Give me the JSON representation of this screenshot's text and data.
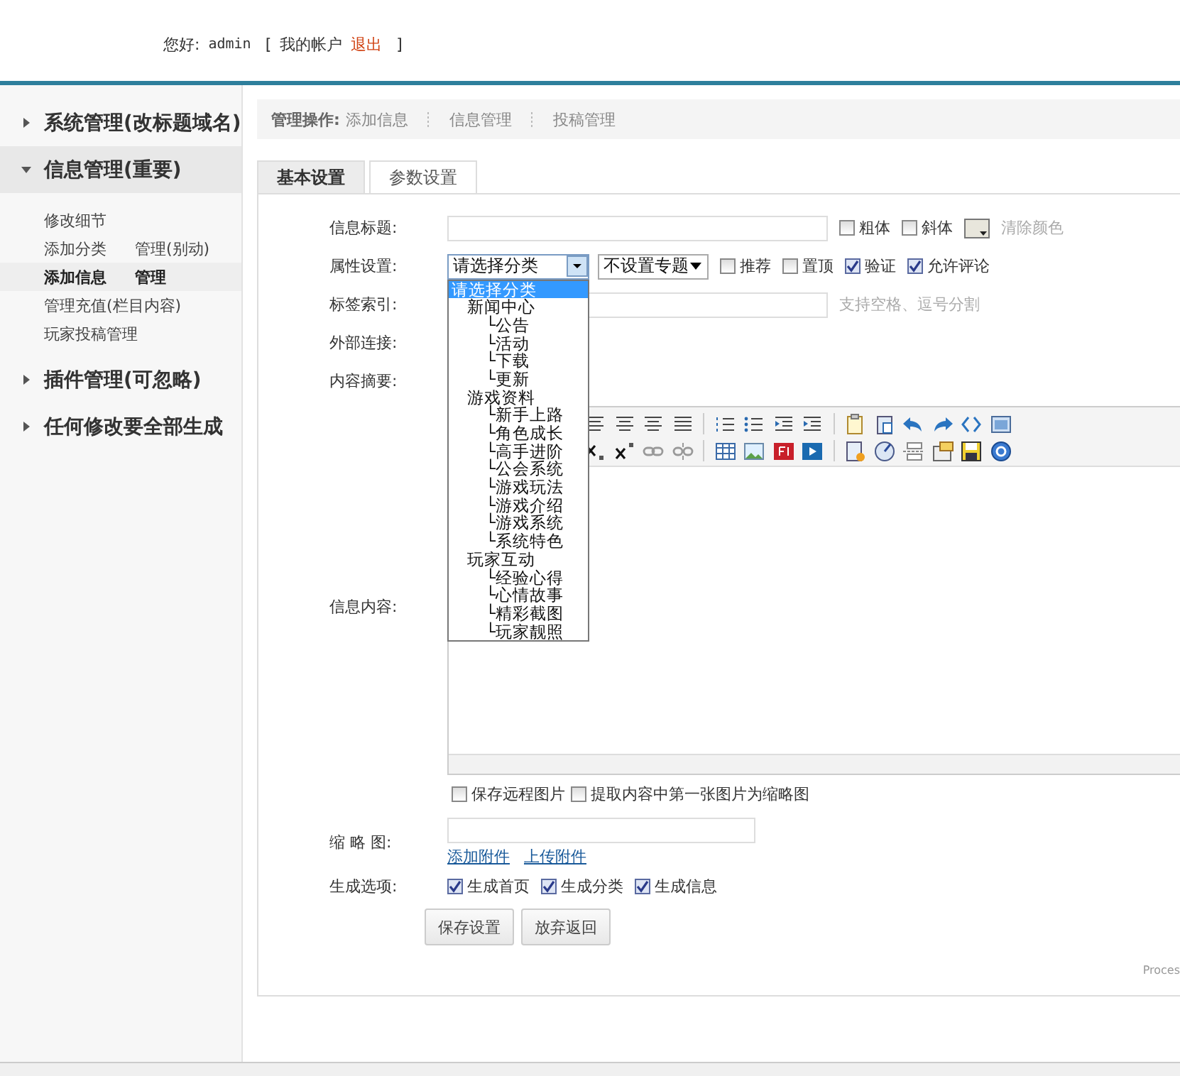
{
  "header": {
    "greeting": "您好:",
    "user": "admin",
    "open_bracket": "[",
    "account_link": "我的帐户",
    "logout_link": "退出",
    "close_bracket": "]"
  },
  "sidebar": {
    "groups": [
      {
        "title": "系统管理(改标题域名)",
        "expanded": false
      },
      {
        "title": "信息管理(重要)",
        "expanded": true,
        "rows": [
          {
            "selected": false,
            "links": [
              "修改细节"
            ]
          },
          {
            "selected": false,
            "links": [
              "添加分类",
              "管理(别动)"
            ]
          },
          {
            "selected": true,
            "links": [
              "添加信息",
              "管理"
            ]
          },
          {
            "selected": false,
            "links": [
              "管理充值(栏目内容)"
            ]
          },
          {
            "selected": false,
            "links": [
              "玩家投稿管理"
            ]
          }
        ]
      },
      {
        "title": "插件管理(可忽略)",
        "expanded": false
      },
      {
        "title": "任何修改要全部生成",
        "expanded": false
      }
    ]
  },
  "breadcrumb": {
    "label": "管理操作:",
    "links": [
      "添加信息",
      "信息管理",
      "投稿管理"
    ]
  },
  "tabs": [
    {
      "label": "基本设置",
      "selected": true
    },
    {
      "label": "参数设置",
      "selected": false
    }
  ],
  "form": {
    "title_row": {
      "label": "信息标题:",
      "options": [
        {
          "label": "粗体",
          "checked": false
        },
        {
          "label": "斜体",
          "checked": false
        }
      ],
      "clear_color": "清除颜色"
    },
    "attr_row": {
      "label": "属性设置:",
      "category_select": "请选择分类",
      "topic_select": "不设置专题",
      "options": [
        {
          "label": "推荐",
          "checked": false
        },
        {
          "label": "置顶",
          "checked": false
        },
        {
          "label": "验证",
          "checked": true
        },
        {
          "label": "允许评论",
          "checked": true
        }
      ]
    },
    "tags_row": {
      "label": "标签索引:",
      "hint": "支持空格、逗号分割"
    },
    "link_row": {
      "label": "外部连接:"
    },
    "summary_row": {
      "label": "内容摘要:"
    },
    "content_row": {
      "label": "信息内容:",
      "options": [
        {
          "label": "保存远程图片",
          "checked": false
        },
        {
          "label": "提取内容中第一张图片为缩略图",
          "checked": false
        }
      ]
    },
    "thumb_row": {
      "label": "缩 略 图:",
      "links": [
        "添加附件",
        "上传附件"
      ]
    },
    "generate_row": {
      "label": "生成选项:",
      "options": [
        {
          "label": "生成首页",
          "checked": true
        },
        {
          "label": "生成分类",
          "checked": true
        },
        {
          "label": "生成信息",
          "checked": true
        }
      ]
    },
    "buttons": [
      "保存设置",
      "放弃返回"
    ],
    "footer_note": "Proces"
  },
  "category_dropdown": {
    "expanded": true,
    "items": [
      {
        "label": "请选择分类",
        "selected": true
      },
      {
        "label": "新闻中心",
        "selected": false,
        "children": [
          {
            "label": "└公告",
            "selected": false
          },
          {
            "label": "└活动",
            "selected": false
          },
          {
            "label": "└下载",
            "selected": false
          },
          {
            "label": "└更新",
            "selected": false
          }
        ]
      },
      {
        "label": "游戏资料",
        "selected": false,
        "children": [
          {
            "label": "└新手上路",
            "selected": false
          },
          {
            "label": "└角色成长",
            "selected": false
          },
          {
            "label": "└高手进阶",
            "selected": false
          },
          {
            "label": "└公会系统",
            "selected": false
          },
          {
            "label": "└游戏玩法",
            "selected": false
          },
          {
            "label": "└游戏介绍",
            "selected": false
          },
          {
            "label": "└游戏系统",
            "selected": false
          },
          {
            "label": "└系统特色",
            "selected": false
          }
        ]
      },
      {
        "label": "玩家互动",
        "selected": false,
        "children": [
          {
            "label": "└经验心得",
            "selected": false
          },
          {
            "label": "└心情故事",
            "selected": false
          },
          {
            "label": "└精彩截图",
            "selected": false
          },
          {
            "label": "└玩家靓照",
            "selected": false
          }
        ]
      }
    ]
  }
}
